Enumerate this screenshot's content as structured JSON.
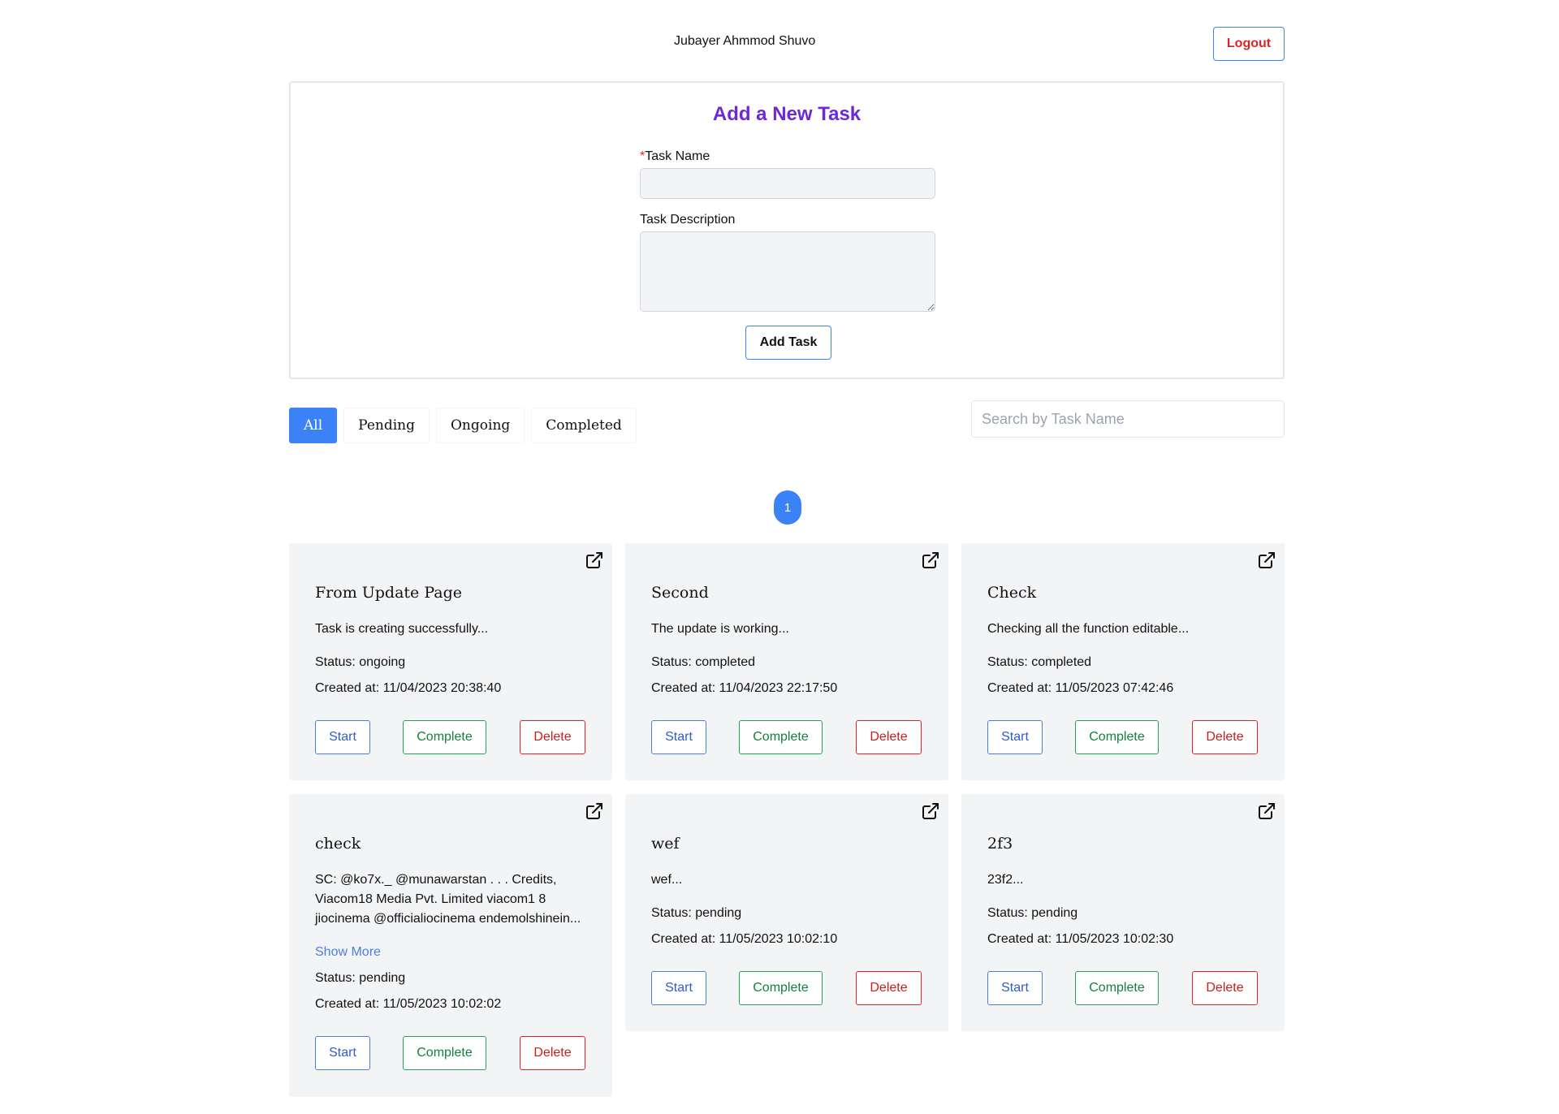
{
  "header": {
    "username": "Jubayer Ahmmod Shuvo",
    "logout_label": "Logout"
  },
  "form": {
    "title": "Add a New Task",
    "required_mark": "*",
    "task_name_label": "Task Name",
    "task_name_value": "",
    "task_description_label": "Task Description",
    "task_description_value": "",
    "submit_label": "Add Task"
  },
  "filters": {
    "tabs": [
      {
        "label": "All",
        "active": true
      },
      {
        "label": "Pending",
        "active": false
      },
      {
        "label": "Ongoing",
        "active": false
      },
      {
        "label": "Completed",
        "active": false
      }
    ],
    "search_placeholder": "Search by Task Name",
    "search_value": ""
  },
  "pagination": {
    "current_page": "1"
  },
  "task_actions": {
    "start_label": "Start",
    "complete_label": "Complete",
    "delete_label": "Delete",
    "status_prefix": "Status: ",
    "created_prefix": "Created at: ",
    "show_more_label": "Show More"
  },
  "tasks": [
    {
      "title": "From Update Page",
      "description": "Task is creating successfully...",
      "status": "ongoing",
      "created_at": "11/04/2023 20:38:40",
      "show_more": false
    },
    {
      "title": "Second",
      "description": "The update is working...",
      "status": "completed",
      "created_at": "11/04/2023 22:17:50",
      "show_more": false
    },
    {
      "title": "Check",
      "description": "Checking all the function editable...",
      "status": "completed",
      "created_at": "11/05/2023 07:42:46",
      "show_more": false
    },
    {
      "title": "check",
      "description": "SC: @ko7x._ @munawarstan . . . Credits, Viacom18 Media Pvt. Limited viacom1 8 jiocinema @officialiocinema endemolshinein...",
      "status": "pending",
      "created_at": "11/05/2023 10:02:02",
      "show_more": true
    },
    {
      "title": "wef",
      "description": "wef...",
      "status": "pending",
      "created_at": "11/05/2023 10:02:10",
      "show_more": false
    },
    {
      "title": "2f3",
      "description": "23f2...",
      "status": "pending",
      "created_at": "11/05/2023 10:02:30",
      "show_more": false
    }
  ],
  "colors": {
    "accent": "#3b82f6",
    "title_purple": "#6d28d9",
    "card_bg": "#f3f4f6",
    "start": "#2f5cc9",
    "complete": "#15803d",
    "delete": "#c81e1e"
  },
  "icons": {
    "card_open": "external-link-icon"
  }
}
